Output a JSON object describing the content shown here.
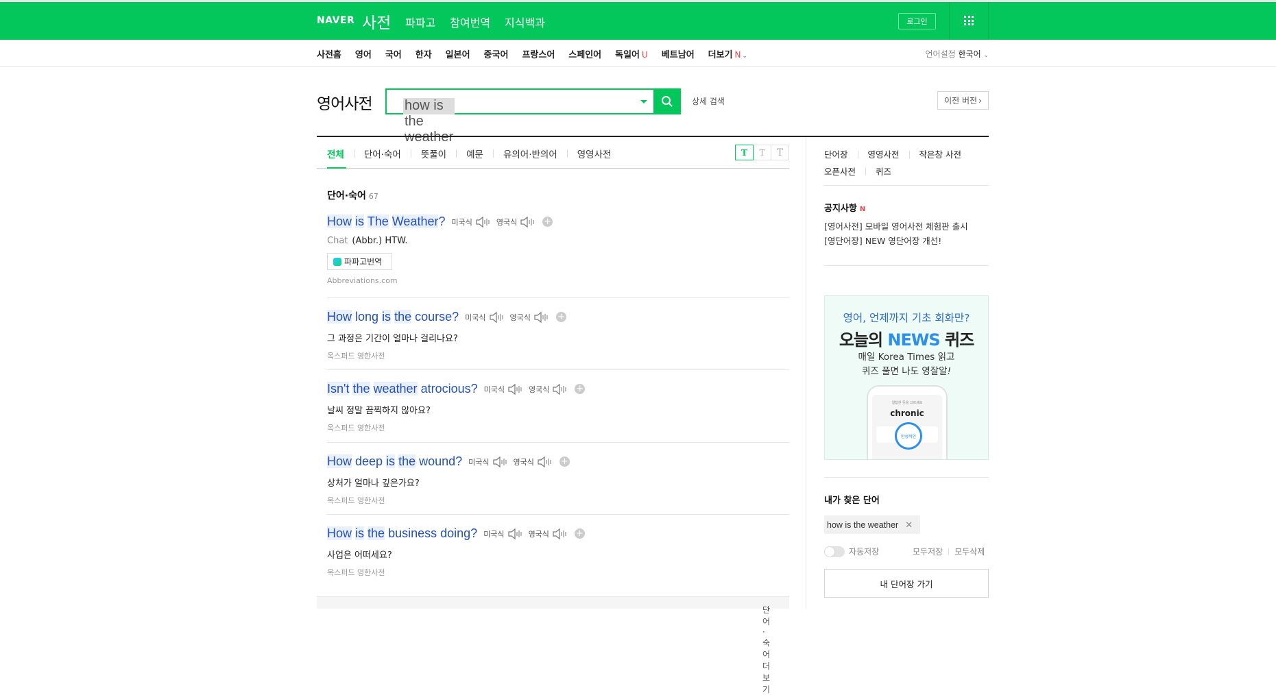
{
  "gnb": {
    "naver_logo": "NAVER",
    "service_title": "사전",
    "menu": [
      "파파고",
      "참여번역",
      "지식백과"
    ],
    "login_label": "로그인",
    "apps_icon": "grid-icon",
    "bg_color": "#03c75a"
  },
  "lnb": {
    "items": [
      "사전홈",
      "영어",
      "국어",
      "한자",
      "일본어",
      "중국어",
      "프랑스어",
      "스페인어",
      "독일어",
      "베트남어",
      "더보기"
    ],
    "new_badge_u": "U",
    "new_badge_n": "N",
    "language_label": "언어설정",
    "language_value": "한국어"
  },
  "search": {
    "title": "영어사전",
    "query": "how is the weather",
    "detail_label": "상세 검색",
    "prev_version_label": "이전 버전"
  },
  "tabs": {
    "items": [
      "전체",
      "단어·숙어",
      "뜻풀이",
      "예문",
      "유의어·반의어",
      "영영사전"
    ],
    "active": "전체",
    "font_sizes": [
      "T",
      "T",
      "T"
    ]
  },
  "section": {
    "title": "단어·숙어",
    "count": "67",
    "more_label": "단어·숙어 더보기"
  },
  "pron": {
    "us": "미국식",
    "uk": "영국식"
  },
  "entries": [
    {
      "word_parts": [
        "How",
        " ",
        "is",
        " ",
        "The",
        " ",
        "Weather",
        "?"
      ],
      "pos": "Chat",
      "meaning": "(Abbr.) HTW.",
      "papago_label": "파파고번역",
      "source": "Abbreviations.com"
    },
    {
      "word_parts": [
        "How",
        " long ",
        "is",
        " ",
        "the",
        " course?"
      ],
      "meaning": "그 과정은 기간이 얼마나 걸리나요?",
      "source": "옥스퍼드 영한사전"
    },
    {
      "word_parts": [
        "Isn't",
        " ",
        "the",
        " ",
        "weather",
        " atrocious?"
      ],
      "meaning": "날씨 정말 끔찍하지 않아요?",
      "source": "옥스퍼드 영한사전"
    },
    {
      "word_parts": [
        "How",
        " deep ",
        "is",
        " ",
        "the",
        " wound?"
      ],
      "meaning": "상처가 얼마나 깊은가요?",
      "source": "옥스퍼드 영한사전"
    },
    {
      "word_parts": [
        "How",
        " ",
        "is",
        " ",
        "the",
        " business doing?"
      ],
      "meaning": "사업은 어떠세요?",
      "source": "옥스퍼드 영한사전"
    }
  ],
  "side": {
    "links_row1": [
      "단어장",
      "영영사전",
      "작은창 사전"
    ],
    "links_row2": [
      "오픈사전",
      "퀴즈"
    ],
    "notice_title": "공지사항",
    "notice_badge": "N",
    "notices": [
      "[영어사전] 모바일 영어사전 체험판 출시",
      "[영단어장] NEW 영단어장 개선!"
    ],
    "banner": {
      "line1": "영어, 언제까지 기초 회화만?",
      "line2_a": "오늘의 ",
      "line2_b": "NEWS",
      "line2_c": " 퀴즈",
      "line3": "매일 Korea Times 읽고",
      "line4_a": "퀴즈 풀면 나도 영잘알",
      "line4_b": "!",
      "phone_small": "알찹한 뜻을 고르세요",
      "phone_word": "chronic",
      "phone_circle": "만성적인"
    },
    "my_words_title": "내가 찾은 단어",
    "my_word_chip": "how is the weather",
    "auto_save": "자동저장",
    "save_all": "모두저장",
    "delete_all": "모두삭제",
    "go_wordbook": "내 단어장 가기"
  }
}
